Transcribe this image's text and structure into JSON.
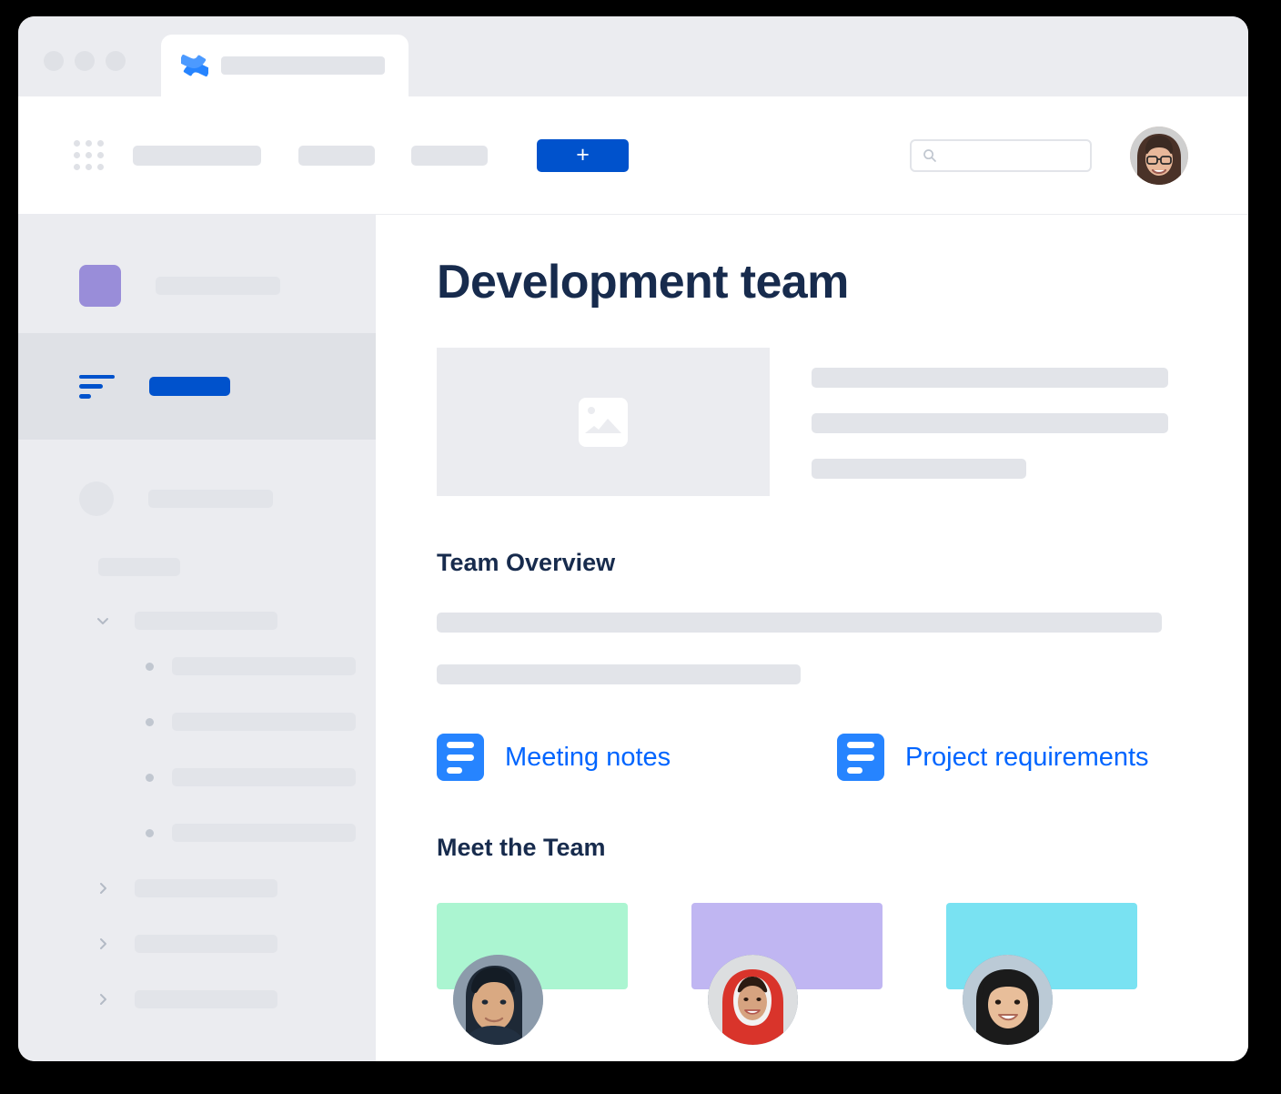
{
  "window": {
    "traffic_lights": [
      "close",
      "minimize",
      "maximize"
    ],
    "tab": {
      "logo_icon": "confluence-logo-icon",
      "title_placeholder": ""
    }
  },
  "topnav": {
    "app_switcher_icon": "grid-apps-icon",
    "nav_items": [
      "",
      "",
      ""
    ],
    "create_label": "+",
    "search": {
      "icon": "search-icon",
      "value": "",
      "placeholder": ""
    },
    "avatar": {
      "icon": "user-avatar",
      "alt": "Account avatar"
    }
  },
  "sidebar": {
    "space": {
      "icon": "space-icon",
      "name": "",
      "color": "#998DD9"
    },
    "active_item": {
      "icon": "content-lines-icon",
      "label": ""
    },
    "items": [
      {
        "icon": "circle-avatar-icon",
        "label": ""
      }
    ],
    "section_label": "",
    "tree": [
      {
        "chevron": "chevron-down-icon",
        "label": "",
        "expanded": true,
        "children": [
          {
            "bullet": "bullet-dot-icon",
            "label": ""
          },
          {
            "bullet": "bullet-dot-icon",
            "label": ""
          },
          {
            "bullet": "bullet-dot-icon",
            "label": ""
          },
          {
            "bullet": "bullet-dot-icon",
            "label": ""
          }
        ]
      },
      {
        "chevron": "chevron-right-icon",
        "label": "",
        "expanded": false,
        "children": []
      },
      {
        "chevron": "chevron-right-icon",
        "label": "",
        "expanded": false,
        "children": []
      },
      {
        "chevron": "chevron-right-icon",
        "label": "",
        "expanded": false,
        "children": []
      }
    ]
  },
  "page": {
    "title": "Development team",
    "hero": {
      "image_icon": "image-placeholder-icon",
      "paragraph_lines": [
        "",
        "",
        ""
      ]
    },
    "overview": {
      "heading": "Team Overview",
      "paragraph_lines": [
        "",
        ""
      ]
    },
    "page_links": [
      {
        "icon": "document-icon",
        "label": "Meeting notes"
      },
      {
        "icon": "document-icon",
        "label": "Project requirements"
      }
    ],
    "team": {
      "heading": "Meet the Team",
      "members": [
        {
          "banner_color": "#ABF5D1",
          "avatar": "team-member-avatar",
          "name": ""
        },
        {
          "banner_color": "#C0B6F2",
          "avatar": "team-member-avatar",
          "name": ""
        },
        {
          "banner_color": "#79E2F2",
          "avatar": "team-member-avatar",
          "name": ""
        }
      ]
    }
  },
  "colors": {
    "brand_blue": "#0052CC",
    "link_blue": "#0065FF",
    "icon_blue": "#2684FF",
    "logo_blue": "#4C9AFF",
    "text_navy": "#172B4D",
    "sidebar_bg": "#EBECF0",
    "skeleton": "#E2E4E9",
    "active_row": "#DFE1E6"
  }
}
